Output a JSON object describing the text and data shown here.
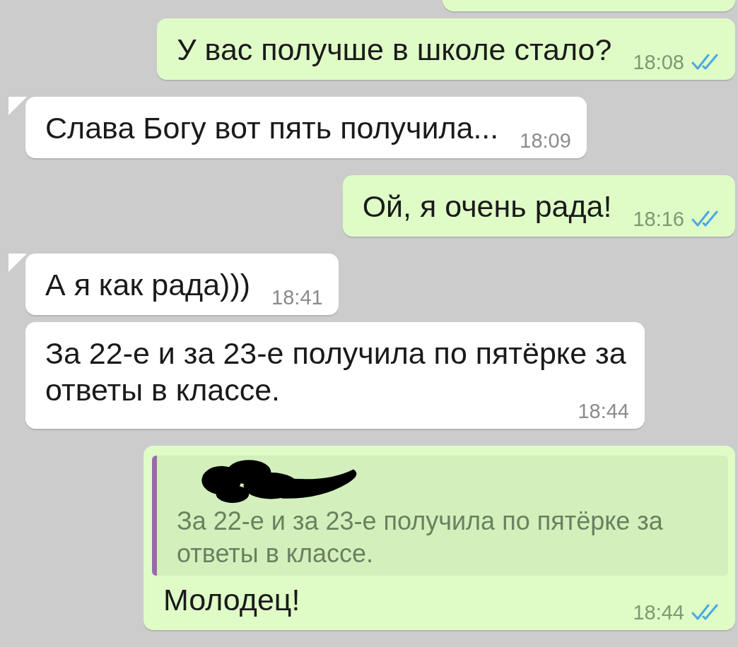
{
  "messages": [
    {
      "kind": "cut",
      "outgoing": true
    },
    {
      "kind": "message",
      "outgoing": true,
      "tail": false,
      "text": "У вас получше в школе стало?",
      "time": "18:08",
      "read": true
    },
    {
      "kind": "message",
      "outgoing": false,
      "tail": true,
      "text": "Слава Богу вот пять получила...",
      "time": "18:09"
    },
    {
      "kind": "message",
      "outgoing": true,
      "tail": false,
      "text": "Ой, я очень рада!",
      "time": "18:16",
      "read": true
    },
    {
      "kind": "message",
      "outgoing": false,
      "tail": true,
      "text": "А я как рада)))",
      "time": "18:41"
    },
    {
      "kind": "message",
      "outgoing": false,
      "tail": false,
      "text": "За 22-е и за 23-е получила по пятёрке за ответы в классе.",
      "time": "18:44"
    },
    {
      "kind": "message",
      "outgoing": true,
      "tail": false,
      "quote": {
        "text": "За 22-е и за 23-е получила по пятёрке за ответы в классе."
      },
      "text": "Молодец!",
      "time": "18:44",
      "read": true
    }
  ]
}
